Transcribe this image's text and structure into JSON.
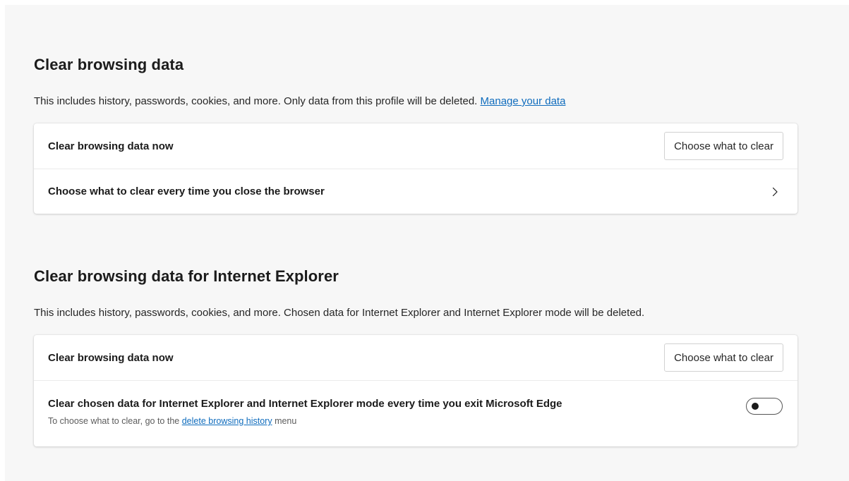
{
  "section1": {
    "title": "Clear browsing data",
    "description": "This includes history, passwords, cookies, and more. Only data from this profile will be deleted.",
    "manage_link": "Manage your data",
    "rows": {
      "clear_now_label": "Clear browsing data now",
      "clear_now_button": "Choose what to clear",
      "on_close_label": "Choose what to clear every time you close the browser"
    }
  },
  "section2": {
    "title": "Clear browsing data for Internet Explorer",
    "description": "This includes history, passwords, cookies, and more. Chosen data for Internet Explorer and Internet Explorer mode will be deleted.",
    "rows": {
      "clear_now_label": "Clear browsing data now",
      "clear_now_button": "Choose what to clear",
      "on_exit_label": "Clear chosen data for Internet Explorer and Internet Explorer mode every time you exit Microsoft Edge",
      "on_exit_sub_prefix": "To choose what to clear, go to the",
      "on_exit_sub_link": "delete browsing history",
      "on_exit_sub_suffix": "menu",
      "on_exit_toggle_on": false
    }
  },
  "colors": {
    "link": "#0f6cbd",
    "page_background": "#f7f7f7",
    "card_background": "#ffffff"
  },
  "icons": {
    "chevron": "chevron-right-icon"
  }
}
